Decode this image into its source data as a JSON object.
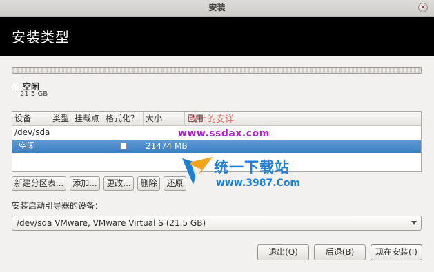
{
  "window": {
    "title": "安装"
  },
  "header": {
    "title": "安装类型"
  },
  "partition_bar": {
    "used_fraction": 0
  },
  "legend": {
    "name": "空闲",
    "size": "21.5 GB"
  },
  "table": {
    "columns": [
      "设备",
      "类型",
      "挂载点",
      "格式化？",
      "大小",
      "已用"
    ],
    "rows": [
      {
        "device": "/dev/sda",
        "type": "",
        "mount": "",
        "format": "",
        "size": "",
        "used": ""
      },
      {
        "device": "空闲",
        "type": "",
        "mount": "",
        "format": "unchecked",
        "size": "21474 MB",
        "used": ""
      }
    ]
  },
  "actions": {
    "new_table": "新建分区表...",
    "add": "添加...",
    "change": "更改...",
    "delete": "删除",
    "revert": "还原"
  },
  "boot": {
    "label": "安装启动引导器的设备：",
    "selected": "/dev/sda  VMware, VMware Virtual S (21.5 GB)"
  },
  "footer": {
    "quit": "退出(Q)",
    "back": "后退(B)",
    "install_now": "现在安装(I)"
  },
  "watermark": {
    "line1": "统计的安详",
    "url1": "www.ssdax.com",
    "brand": "统一下载站",
    "url2": "www.3987.Com"
  },
  "colors": {
    "header_bg": "#000000",
    "selection": "#4a8acb",
    "brand_blue": "#1e7fd6",
    "watermark_purple": "#b020d0"
  }
}
